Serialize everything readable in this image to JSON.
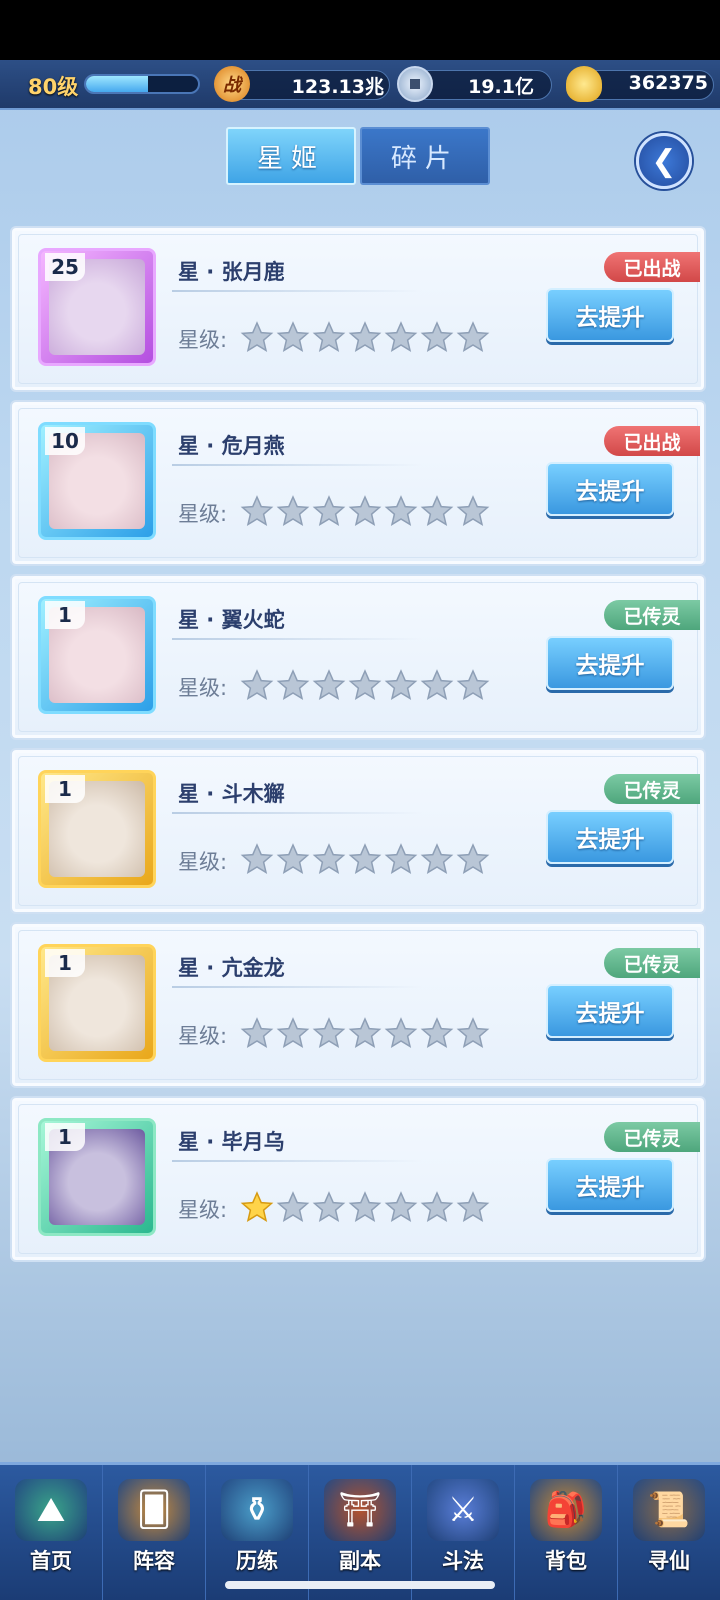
{
  "resources": {
    "level": "80级",
    "exp_fraction": 0.55,
    "power_icon_text": "战",
    "power": "123.13兆",
    "silver": "19.1亿",
    "gold": "362375"
  },
  "tabs": [
    {
      "label": "星姬",
      "active": true
    },
    {
      "label": "碎片",
      "active": false
    }
  ],
  "star_label": "星级:",
  "upgrade_label": "去提升",
  "heroes": [
    {
      "level": "25",
      "name": "星 · 张月鹿",
      "status": "已出战",
      "status_color": "#d24848",
      "frame": "purple",
      "stars_lit": 0
    },
    {
      "level": "10",
      "name": "星 · 危月燕",
      "status": "已出战",
      "status_color": "#d24848",
      "frame": "blue",
      "stars_lit": 0
    },
    {
      "level": "1",
      "name": "星 · 翼火蛇",
      "status": "已传灵",
      "status_color": "#4ea67c",
      "frame": "blue",
      "stars_lit": 0
    },
    {
      "level": "1",
      "name": "星 · 斗木獬",
      "status": "已传灵",
      "status_color": "#4ea67c",
      "frame": "gold",
      "stars_lit": 0
    },
    {
      "level": "1",
      "name": "星 · 亢金龙",
      "status": "已传灵",
      "status_color": "#4ea67c",
      "frame": "gold",
      "stars_lit": 0
    },
    {
      "level": "1",
      "name": "星 · 毕月乌",
      "status": "已传灵",
      "status_color": "#4ea67c",
      "frame": "teal",
      "stars_lit": 1
    }
  ],
  "max_stars": 7,
  "nav": [
    {
      "label": "首页",
      "icon": "home-island-icon"
    },
    {
      "label": "阵容",
      "icon": "lineup-cards-icon"
    },
    {
      "label": "历练",
      "icon": "training-gourd-icon"
    },
    {
      "label": "副本",
      "icon": "dungeon-gate-icon"
    },
    {
      "label": "斗法",
      "icon": "battle-sword-icon"
    },
    {
      "label": "背包",
      "icon": "backpack-bag-icon"
    },
    {
      "label": "寻仙",
      "icon": "quest-scroll-icon"
    }
  ]
}
